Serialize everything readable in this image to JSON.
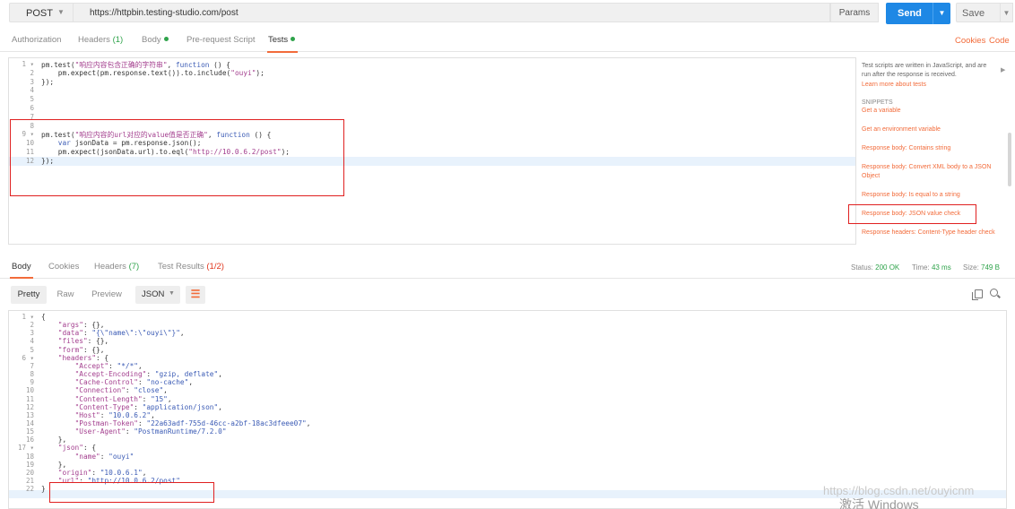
{
  "request": {
    "method": "POST",
    "url": "https://httpbin.testing-studio.com/post",
    "params_label": "Params",
    "send_label": "Send",
    "save_label": "Save"
  },
  "request_tabs": {
    "authorization": "Authorization",
    "headers": "Headers",
    "headers_count": "(1)",
    "body": "Body",
    "prerequest": "Pre-request Script",
    "tests": "Tests",
    "cookies": "Cookies",
    "code": "Code"
  },
  "editor": {
    "lines": [
      {
        "n": "1",
        "fold": true,
        "text": "pm.test(\"响应内容包含正确的字符串\", function () {"
      },
      {
        "n": "2",
        "fold": false,
        "text": "    pm.expect(pm.response.text()).to.include(\"ouyi\");"
      },
      {
        "n": "3",
        "fold": false,
        "text": "});"
      },
      {
        "n": "4",
        "fold": false,
        "text": ""
      },
      {
        "n": "5",
        "fold": false,
        "text": ""
      },
      {
        "n": "6",
        "fold": false,
        "text": ""
      },
      {
        "n": "7",
        "fold": false,
        "text": ""
      },
      {
        "n": "8",
        "fold": false,
        "text": ""
      },
      {
        "n": "9",
        "fold": true,
        "text": "pm.test(\"响应内容的url对应的value值是否正确\", function () {"
      },
      {
        "n": "10",
        "fold": false,
        "text": "    var jsonData = pm.response.json();"
      },
      {
        "n": "11",
        "fold": false,
        "text": "    pm.expect(jsonData.url).to.eql(\"http://10.0.6.2/post\");"
      },
      {
        "n": "12",
        "fold": false,
        "text": "});"
      }
    ]
  },
  "snippets": {
    "info": "Test scripts are written in JavaScript, and are run after the response is received.",
    "learn_more": "Learn more about tests",
    "heading": "SNIPPETS",
    "items": [
      "Get a variable",
      "Get an environment variable",
      "Response body: Contains string",
      "Response body: Convert XML body to a JSON Object",
      "Response body: Is equal to a string",
      "Response body: JSON value check",
      "Response headers: Content-Type header check"
    ]
  },
  "response_tabs": {
    "body": "Body",
    "cookies": "Cookies",
    "headers": "Headers",
    "headers_count": "(7)",
    "test_results": "Test Results",
    "test_results_count": "(1/2)",
    "status_label": "Status:",
    "status_value": "200 OK",
    "time_label": "Time:",
    "time_value": "43 ms",
    "size_label": "Size:",
    "size_value": "749 B"
  },
  "response_toolbar": {
    "pretty": "Pretty",
    "raw": "Raw",
    "preview": "Preview",
    "format": "JSON"
  },
  "response_body": {
    "lines": [
      {
        "n": "1",
        "fold": true,
        "text": "{"
      },
      {
        "n": "2",
        "fold": false,
        "text": "    \"args\": {},"
      },
      {
        "n": "3",
        "fold": false,
        "text": "    \"data\": \"{\\\"name\\\":\\\"ouyi\\\"}\","
      },
      {
        "n": "4",
        "fold": false,
        "text": "    \"files\": {},"
      },
      {
        "n": "5",
        "fold": false,
        "text": "    \"form\": {},"
      },
      {
        "n": "6",
        "fold": true,
        "text": "    \"headers\": {"
      },
      {
        "n": "7",
        "fold": false,
        "text": "        \"Accept\": \"*/*\","
      },
      {
        "n": "8",
        "fold": false,
        "text": "        \"Accept-Encoding\": \"gzip, deflate\","
      },
      {
        "n": "9",
        "fold": false,
        "text": "        \"Cache-Control\": \"no-cache\","
      },
      {
        "n": "10",
        "fold": false,
        "text": "        \"Connection\": \"close\","
      },
      {
        "n": "11",
        "fold": false,
        "text": "        \"Content-Length\": \"15\","
      },
      {
        "n": "12",
        "fold": false,
        "text": "        \"Content-Type\": \"application/json\","
      },
      {
        "n": "13",
        "fold": false,
        "text": "        \"Host\": \"10.0.6.2\","
      },
      {
        "n": "14",
        "fold": false,
        "text": "        \"Postman-Token\": \"22a63adf-755d-46cc-a2bf-18ac3dfeee07\","
      },
      {
        "n": "15",
        "fold": false,
        "text": "        \"User-Agent\": \"PostmanRuntime/7.2.0\""
      },
      {
        "n": "16",
        "fold": false,
        "text": "    },"
      },
      {
        "n": "17",
        "fold": true,
        "text": "    \"json\": {"
      },
      {
        "n": "18",
        "fold": false,
        "text": "        \"name\": \"ouyi\""
      },
      {
        "n": "19",
        "fold": false,
        "text": "    },"
      },
      {
        "n": "20",
        "fold": false,
        "text": "    \"origin\": \"10.0.6.1\","
      },
      {
        "n": "21",
        "fold": false,
        "text": "    \"url\": \"http://10.0.6.2/post\""
      },
      {
        "n": "22",
        "fold": false,
        "text": "}"
      }
    ]
  },
  "overlay": {
    "watermark": "https://blog.csdn.net/ouyicnm",
    "activate": "激活 Windows"
  },
  "colors": {
    "accent": "#f26b3a",
    "send": "#1e88e5",
    "success": "#2fa34b",
    "annotation": "#e02020"
  }
}
